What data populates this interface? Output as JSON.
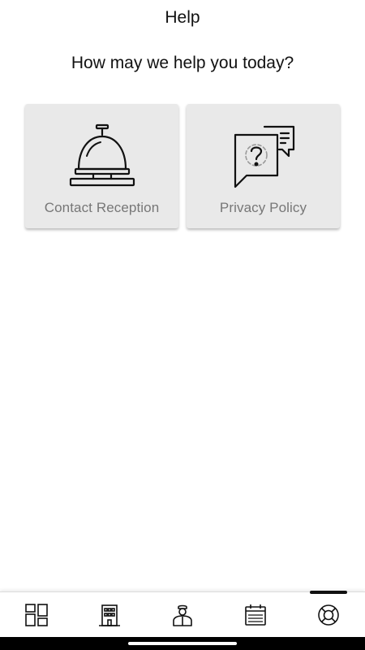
{
  "header": {
    "title": "Help"
  },
  "main": {
    "prompt": "How may we help you today?",
    "cards": [
      {
        "label": "Contact Reception",
        "icon": "reception-bell-icon"
      },
      {
        "label": "Privacy Policy",
        "icon": "help-chat-bubbles-icon"
      }
    ]
  },
  "bottom_nav": {
    "items": [
      {
        "icon": "dashboard-grid-icon"
      },
      {
        "icon": "hotel-building-icon"
      },
      {
        "icon": "concierge-person-icon"
      },
      {
        "icon": "calendar-icon"
      },
      {
        "icon": "lifebuoy-help-icon",
        "active": true
      }
    ]
  },
  "colors": {
    "card_background": "#e9e9e9",
    "card_label": "#777777",
    "text": "#111111",
    "active_indicator": "#111111"
  }
}
